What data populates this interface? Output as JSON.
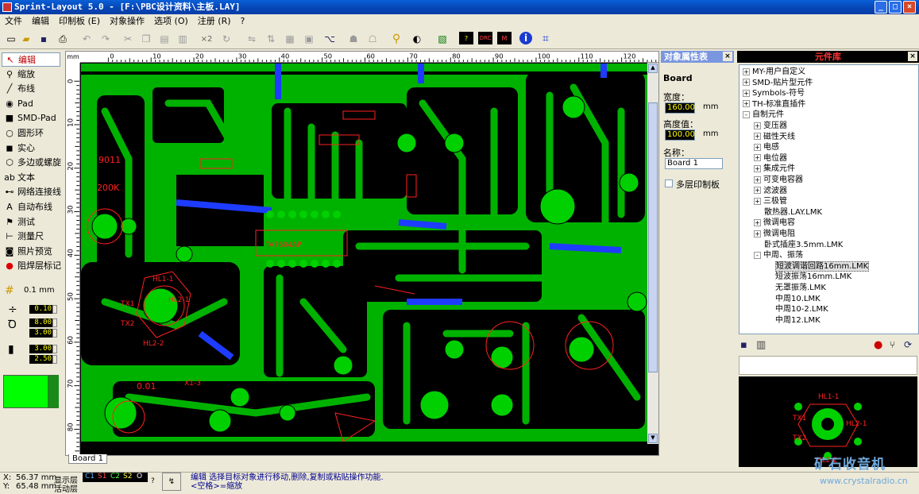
{
  "window": {
    "title": "Sprint-Layout 5.0 - [F:\\PBC设计资料\\主板.LAY]"
  },
  "menu": [
    "文件",
    "编辑",
    "印制板 (E)",
    "对象操作",
    "选项 (O)",
    "注册 (R)",
    "?"
  ],
  "tools": [
    {
      "label": "编辑",
      "icon": "arrow-cursor-icon",
      "active": true
    },
    {
      "label": "缩放",
      "icon": "zoom-icon"
    },
    {
      "label": "布线",
      "icon": "track-icon"
    },
    {
      "label": "Pad",
      "icon": "pad-icon"
    },
    {
      "label": "SMD-Pad",
      "icon": "smd-pad-icon"
    },
    {
      "label": "圆形环",
      "icon": "circle-icon"
    },
    {
      "label": "实心",
      "icon": "fill-icon"
    },
    {
      "label": "多边或螺旋",
      "icon": "polygon-icon"
    },
    {
      "label": "文本",
      "icon": "text-icon"
    },
    {
      "label": "网络连接线",
      "icon": "connection-icon"
    },
    {
      "label": "自动布线",
      "icon": "autoroute-icon"
    },
    {
      "label": "测试",
      "icon": "test-icon"
    },
    {
      "label": "测量尺",
      "icon": "ruler-icon"
    },
    {
      "label": "照片预览",
      "icon": "camera-icon"
    },
    {
      "label": "阻焊层标记",
      "icon": "solder-mask-icon"
    }
  ],
  "grid": {
    "value": "0.1 mm"
  },
  "track_widths": [
    "0.10",
    "8.00",
    "3.00",
    "3.00",
    "2.50"
  ],
  "ruler": {
    "unit": "mm",
    "h_ticks": [
      "0",
      "10",
      "20",
      "30",
      "40",
      "50",
      "60",
      "70",
      "80",
      "90",
      "100",
      "110",
      "120"
    ],
    "v_ticks": [
      "0",
      "10",
      "20",
      "30",
      "40",
      "50",
      "60",
      "70",
      "80"
    ]
  },
  "tabs": [
    "Board 1"
  ],
  "props": {
    "title": "对象属性表",
    "object_name": "Board",
    "width_label": "宽度：",
    "width_value": "160.00",
    "width_unit": "mm",
    "height_label": "高度值：",
    "height_value": "100.00",
    "height_unit": "mm",
    "name_label": "名称：",
    "name_value": "Board 1",
    "multilayer_label": "多层印制板"
  },
  "library": {
    "title": "元件库",
    "items": [
      {
        "label": "MY-用户自定义",
        "indent": 0,
        "expander": "+"
      },
      {
        "label": "SMD-贴片型元件",
        "indent": 0,
        "expander": "+"
      },
      {
        "label": "Symbols-符号",
        "indent": 0,
        "expander": "+"
      },
      {
        "label": "TH-标准直插件",
        "indent": 0,
        "expander": "+"
      },
      {
        "label": "自制元件",
        "indent": 0,
        "expander": "-"
      },
      {
        "label": "变压器",
        "indent": 1,
        "expander": "+"
      },
      {
        "label": "磁性天线",
        "indent": 1,
        "expander": "+"
      },
      {
        "label": "电感",
        "indent": 1,
        "expander": "+"
      },
      {
        "label": "电位器",
        "indent": 1,
        "expander": "+"
      },
      {
        "label": "集成元件",
        "indent": 1,
        "expander": "+"
      },
      {
        "label": "可变电容器",
        "indent": 1,
        "expander": "+"
      },
      {
        "label": "滤波器",
        "indent": 1,
        "expander": "+"
      },
      {
        "label": "三极管",
        "indent": 1,
        "expander": "+"
      },
      {
        "label": "散热器.LAY.LMK",
        "indent": 1,
        "expander": ""
      },
      {
        "label": "微调电容",
        "indent": 1,
        "expander": "+"
      },
      {
        "label": "微调电阻",
        "indent": 1,
        "expander": "+"
      },
      {
        "label": "卧式插座3.5mm.LMK",
        "indent": 1,
        "expander": ""
      },
      {
        "label": "中周、振荡",
        "indent": 1,
        "expander": "-"
      },
      {
        "label": "短波调谐回路16mm.LMK",
        "indent": 2,
        "expander": "",
        "selected": true
      },
      {
        "label": "短波振荡16mm.LMK",
        "indent": 2,
        "expander": ""
      },
      {
        "label": "无罩振荡.LMK",
        "indent": 2,
        "expander": ""
      },
      {
        "label": "中周10.LMK",
        "indent": 2,
        "expander": ""
      },
      {
        "label": "中周10-2.LMK",
        "indent": 2,
        "expander": ""
      },
      {
        "label": "中周12.LMK",
        "indent": 2,
        "expander": ""
      }
    ]
  },
  "status": {
    "x_label": "X:",
    "x_value": "56.37 mm",
    "y_label": "Y:",
    "y_value": "65.48 mm",
    "visible_label": "显示层",
    "active_label": "活动层",
    "layers": [
      "C1",
      "S1",
      "C2",
      "S2",
      "O"
    ],
    "hint_line1": "编辑 选择目标对象进行移动,删除,复制或粘贴操作功能.",
    "hint_line2": "<空格>=缩放"
  },
  "pcb_labels": [
    "TA7604AP",
    "9011",
    "200K",
    "HL1-1",
    "HL2-1",
    "HL2-2",
    "TX1",
    "TX2",
    "0.01",
    "X1-3"
  ],
  "preview_labels": [
    "HL1-1",
    "HL2-1",
    "HL2-2",
    "TX1",
    "TX2"
  ],
  "watermark": {
    "line1": "矿石收音机",
    "line2": "www.crystalradio.cn"
  },
  "colors": {
    "board": "#00b200",
    "copper": "#00d000",
    "silk": "#ff2020",
    "bridge": "#1e3cff",
    "panel_title": "#7a96df"
  }
}
